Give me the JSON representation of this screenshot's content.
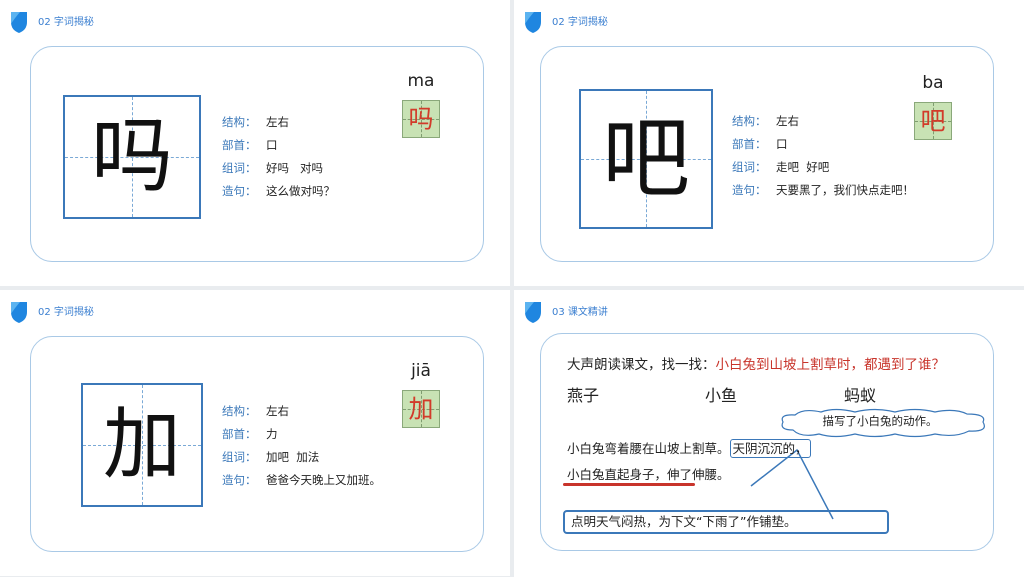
{
  "slides": [
    {
      "section": "02  字词揭秘",
      "char": "吗",
      "pinyin": "ma",
      "rows": [
        {
          "label": "结构：",
          "value": "左右"
        },
        {
          "label": "部首：",
          "value": "口"
        },
        {
          "label": "组词：",
          "value": "好吗   对吗"
        },
        {
          "label": "造句：",
          "value": "这么做对吗？"
        }
      ]
    },
    {
      "section": "02  字词揭秘",
      "char": "吧",
      "pinyin": "ba",
      "rows": [
        {
          "label": "结构：",
          "value": "左右"
        },
        {
          "label": "部首：",
          "value": "口"
        },
        {
          "label": "组词：",
          "value": "走吧  好吧"
        },
        {
          "label": "造句：",
          "value": "天要黑了，我们快点走吧！"
        }
      ]
    },
    {
      "section": "02  字词揭秘",
      "char": "加",
      "pinyin": "jiā",
      "rows": [
        {
          "label": "结构：",
          "value": "左右"
        },
        {
          "label": "部首：",
          "value": "力"
        },
        {
          "label": "组词：",
          "value": "加吧  加法"
        },
        {
          "label": "造句：",
          "value": "爸爸今天晚上又加班。"
        }
      ]
    }
  ],
  "lesson": {
    "section": "03  课文精讲",
    "question_prefix": "大声朗读课文，找一找：",
    "question_red": "小白兔到山坡上割草时，都遇到了谁？",
    "options": [
      "燕子",
      "小鱼",
      "蚂蚁"
    ],
    "cloud_note": "描写了小白兔的动作。",
    "line1_a": "小白兔弯着腰在山坡上割草。",
    "line1_b": "天阴沉沉的，",
    "line2_a": "小白兔直起身子，",
    "line2_b": "伸了伸腰。",
    "callout": "点明天气闷热，为下文“下雨了”作铺垫。"
  },
  "colors": {
    "accent": "#3b78b9",
    "red": "#c8342b",
    "tile_green": "#c8e2b4"
  }
}
